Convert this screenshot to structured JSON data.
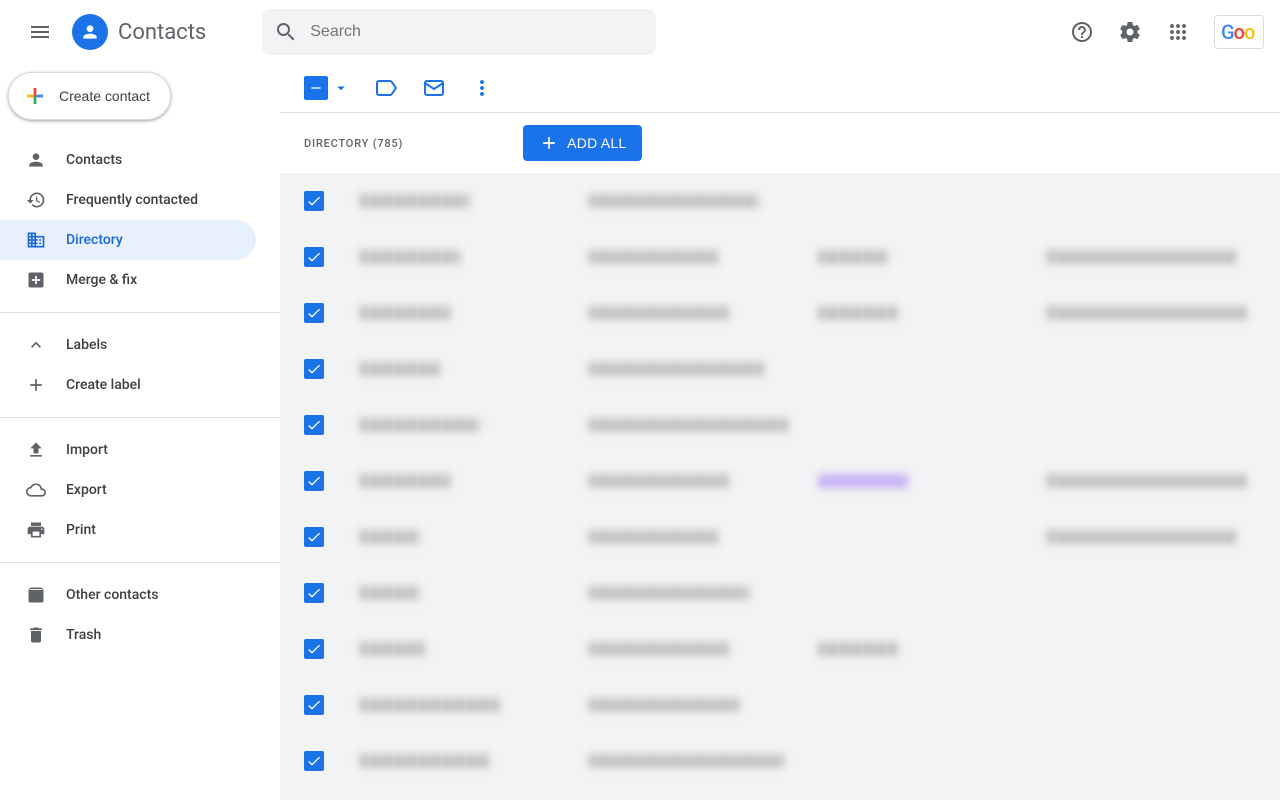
{
  "app": {
    "title": "Contacts"
  },
  "search": {
    "placeholder": "Search"
  },
  "create_button": "Create contact",
  "sidebar": {
    "items": [
      {
        "label": "Contacts"
      },
      {
        "label": "Frequently contacted"
      },
      {
        "label": "Directory"
      },
      {
        "label": "Merge & fix"
      }
    ],
    "labels_header": "Labels",
    "create_label": "Create label",
    "import": "Import",
    "export": "Export",
    "print": "Print",
    "other_contacts": "Other contacts",
    "trash": "Trash"
  },
  "directory": {
    "label": "Directory (785)",
    "add_all": "ADD ALL"
  },
  "google_badge": "Goo",
  "rows": [
    {
      "w1": 110,
      "w2": 170,
      "w3": 0,
      "w4": 0
    },
    {
      "w1": 100,
      "w2": 130,
      "w3": 70,
      "w4": 190
    },
    {
      "w1": 90,
      "w2": 140,
      "w3": 80,
      "w4": 200
    },
    {
      "w1": 80,
      "w2": 175,
      "w3": 0,
      "w4": 0
    },
    {
      "w1": 120,
      "w2": 200,
      "w3": 0,
      "w4": 0
    },
    {
      "w1": 90,
      "w2": 140,
      "w3": 90,
      "w4": 200,
      "purple3": true
    },
    {
      "w1": 60,
      "w2": 130,
      "w3": 0,
      "w4": 190
    },
    {
      "w1": 60,
      "w2": 160,
      "w3": 0,
      "w4": 0
    },
    {
      "w1": 65,
      "w2": 140,
      "w3": 80,
      "w4": 0
    },
    {
      "w1": 140,
      "w2": 150,
      "w3": 0,
      "w4": 0
    },
    {
      "w1": 130,
      "w2": 195,
      "w3": 0,
      "w4": 0
    }
  ]
}
